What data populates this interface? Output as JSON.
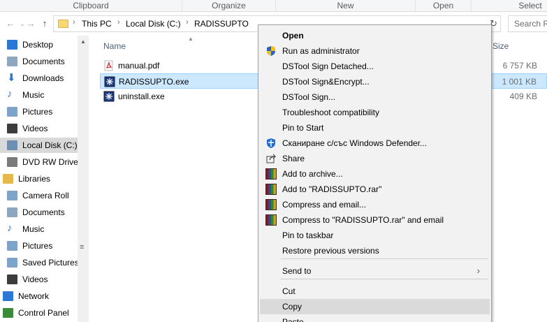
{
  "ribbon": {
    "groups": [
      "Clipboard",
      "Organize",
      "New",
      "Open",
      "Select"
    ]
  },
  "nav": {
    "back_icon": "arrow-left-icon",
    "forward_icon": "arrow-right-icon",
    "recent_icon": "chevron-down-icon",
    "up_icon": "arrow-up-icon",
    "breadcrumb": [
      "This PC",
      "Local Disk (C:)",
      "RADISSUPTO"
    ],
    "search_placeholder": "Search RA"
  },
  "sidebar": {
    "items": [
      {
        "label": "Desktop",
        "icon": "desktop-icon",
        "color": "#2b78d6"
      },
      {
        "label": "Documents",
        "icon": "documents-icon",
        "color": "#8ea6c0"
      },
      {
        "label": "Downloads",
        "icon": "downloads-icon",
        "color": "#2b78d6"
      },
      {
        "label": "Music",
        "icon": "music-icon",
        "color": "#2b78d6"
      },
      {
        "label": "Pictures",
        "icon": "pictures-icon",
        "color": "#7ea2c8"
      },
      {
        "label": "Videos",
        "icon": "videos-icon",
        "color": "#3c3c3c"
      },
      {
        "label": "Local Disk (C:)",
        "icon": "drive-icon",
        "color": "#6d8fb0",
        "selected": true
      },
      {
        "label": "DVD RW Drive",
        "icon": "dvd-icon",
        "color": "#7a7a7a"
      },
      {
        "label": "Libraries",
        "icon": "libraries-icon",
        "color": "#e6b84a"
      },
      {
        "label": "Camera Roll",
        "icon": "camera-roll-icon",
        "color": "#7ea2c8"
      },
      {
        "label": "Documents",
        "icon": "documents-icon",
        "color": "#8ea6c0"
      },
      {
        "label": "Music",
        "icon": "music-icon",
        "color": "#2b78d6"
      },
      {
        "label": "Pictures",
        "icon": "pictures-icon",
        "color": "#7ea2c8"
      },
      {
        "label": "Saved Pictures",
        "icon": "saved-pictures-icon",
        "color": "#7ea2c8"
      },
      {
        "label": "Videos",
        "icon": "videos-icon",
        "color": "#3c3c3c"
      },
      {
        "label": "Network",
        "icon": "network-icon",
        "color": "#2b78d6"
      },
      {
        "label": "Control Panel",
        "icon": "control-panel-icon",
        "color": "#3a8a3a"
      }
    ]
  },
  "files": {
    "columns": {
      "name": "Name",
      "size": "Size"
    },
    "rows": [
      {
        "name": "manual.pdf",
        "size": "6 757 KB",
        "icon": "pdf-icon"
      },
      {
        "name": "RADISSUPTO.exe",
        "size": "1 001 KB",
        "icon": "exe-icon",
        "selected": true
      },
      {
        "name": "uninstall.exe",
        "size": "409 KB",
        "icon": "exe-icon"
      }
    ]
  },
  "context_menu": {
    "items": [
      {
        "label": "Open",
        "bold": true,
        "icon": ""
      },
      {
        "label": "Run as administrator",
        "icon": "uac-shield-icon"
      },
      {
        "label": "DSTool Sign Detached...",
        "icon": ""
      },
      {
        "label": "DSTool Sign&Encrypt...",
        "icon": ""
      },
      {
        "label": "DSTool Sign...",
        "icon": ""
      },
      {
        "label": "Troubleshoot compatibility",
        "icon": ""
      },
      {
        "label": "Pin to Start",
        "icon": ""
      },
      {
        "label": "Сканиране с/със Windows Defender...",
        "icon": "defender-icon"
      },
      {
        "label": "Share",
        "icon": "share-icon"
      },
      {
        "label": "Add to archive...",
        "icon": "winrar-icon"
      },
      {
        "label": "Add to \"RADISSUPTO.rar\"",
        "icon": "winrar-icon"
      },
      {
        "label": "Compress and email...",
        "icon": "winrar-icon"
      },
      {
        "label": "Compress to \"RADISSUPTO.rar\" and email",
        "icon": "winrar-icon"
      },
      {
        "label": "Pin to taskbar",
        "icon": ""
      },
      {
        "label": "Restore previous versions",
        "icon": ""
      },
      {
        "label": "Send to",
        "icon": "",
        "submenu": true
      },
      {
        "label": "Cut",
        "icon": ""
      },
      {
        "label": "Copy",
        "icon": "",
        "hover": true
      },
      {
        "label": "Paste",
        "icon": ""
      }
    ]
  },
  "colors": {
    "selection_bg": "#cce8ff",
    "selection_border": "#99d1ff",
    "menu_bg": "#f2f2f2",
    "menu_hover": "#dadada",
    "header_text": "#4c607a"
  }
}
